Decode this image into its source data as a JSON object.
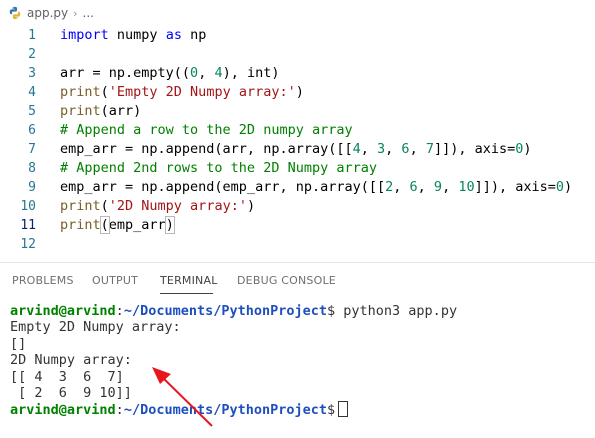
{
  "breadcrumb": {
    "file": "app.py",
    "more": "..."
  },
  "editor": {
    "lines": [
      {
        "n": "1",
        "parts": [
          [
            "kw",
            "import"
          ],
          [
            "",
            " numpy "
          ],
          [
            "kw",
            "as"
          ],
          [
            "",
            " np"
          ]
        ]
      },
      {
        "n": "2",
        "parts": []
      },
      {
        "n": "3",
        "parts": [
          [
            "",
            "arr = np.empty(("
          ],
          [
            "num",
            "0"
          ],
          [
            "",
            ", "
          ],
          [
            "num",
            "4"
          ],
          [
            "",
            "), int)"
          ]
        ]
      },
      {
        "n": "4",
        "parts": [
          [
            "fn",
            "print"
          ],
          [
            "",
            "("
          ],
          [
            "str",
            "'Empty 2D Numpy array:'"
          ],
          [
            "",
            ")"
          ]
        ]
      },
      {
        "n": "5",
        "parts": [
          [
            "fn",
            "print"
          ],
          [
            "",
            "(arr)"
          ]
        ]
      },
      {
        "n": "6",
        "parts": [
          [
            "cmt",
            "# Append a row to the 2D numpy array"
          ]
        ]
      },
      {
        "n": "7",
        "parts": [
          [
            "",
            "emp_arr = np.append(arr, np.array([["
          ],
          [
            "num",
            "4"
          ],
          [
            "",
            ", "
          ],
          [
            "num",
            "3"
          ],
          [
            "",
            ", "
          ],
          [
            "num",
            "6"
          ],
          [
            "",
            ", "
          ],
          [
            "num",
            "7"
          ],
          [
            "",
            "]]), axis="
          ],
          [
            "num",
            "0"
          ],
          [
            "",
            ")"
          ]
        ]
      },
      {
        "n": "8",
        "parts": [
          [
            "cmt",
            "# Append 2nd rows to the 2D Numpy array"
          ]
        ]
      },
      {
        "n": "9",
        "parts": [
          [
            "",
            "emp_arr = np.append(emp_arr, np.array([["
          ],
          [
            "num",
            "2"
          ],
          [
            "",
            ", "
          ],
          [
            "num",
            "6"
          ],
          [
            "",
            ", "
          ],
          [
            "num",
            "9"
          ],
          [
            "",
            ", "
          ],
          [
            "num",
            "10"
          ],
          [
            "",
            "]]), axis="
          ],
          [
            "num",
            "0"
          ],
          [
            "",
            ")"
          ]
        ]
      },
      {
        "n": "10",
        "parts": [
          [
            "fn",
            "print"
          ],
          [
            "",
            "("
          ],
          [
            "str",
            "'2D Numpy array:'"
          ],
          [
            "",
            ")"
          ]
        ]
      },
      {
        "n": "11",
        "parts": [
          [
            "fn",
            "print"
          ],
          [
            "brk",
            "("
          ],
          [
            "",
            "emp_arr"
          ],
          [
            "brk",
            ")"
          ]
        ],
        "current": true
      },
      {
        "n": "12",
        "parts": []
      }
    ]
  },
  "panel": {
    "tabs": [
      "PROBLEMS",
      "OUTPUT",
      "TERMINAL",
      "DEBUG CONSOLE"
    ],
    "active_tab": "TERMINAL"
  },
  "terminal": {
    "user": "arvind@arvind",
    "path": "~/Documents/PythonProject",
    "command": "python3 app.py",
    "output": [
      "Empty 2D Numpy array:",
      "[]",
      "2D Numpy array:",
      "[[ 4  3  6  7]",
      " [ 2  6  9 10]]"
    ]
  },
  "colors": {
    "arrow": "#e8161b",
    "prompt_user": "#008000",
    "prompt_path": "#1e4fbf"
  }
}
